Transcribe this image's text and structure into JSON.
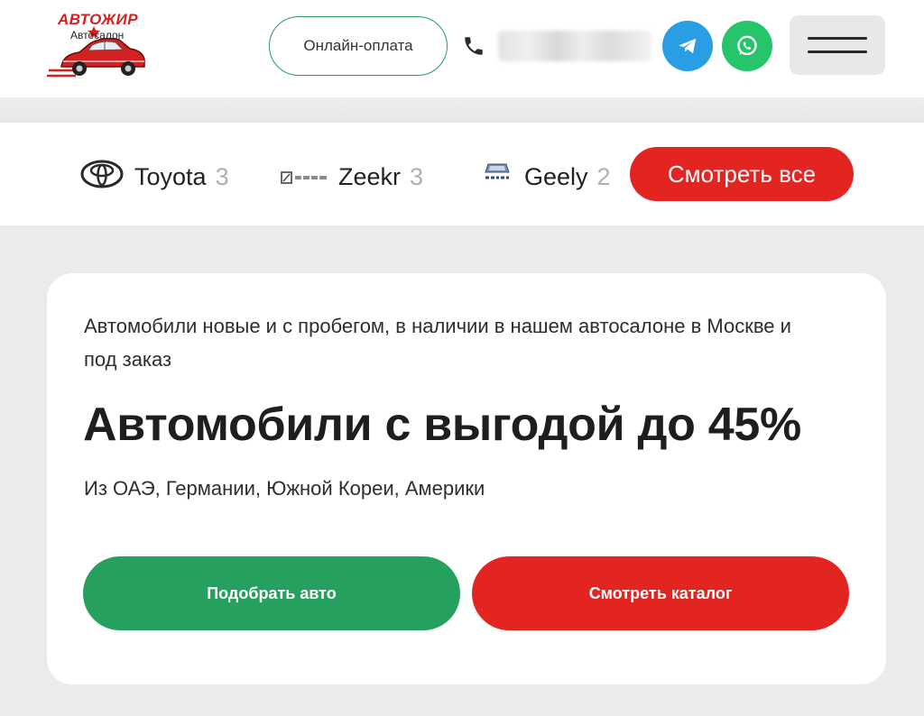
{
  "header": {
    "logo_title": "АВТОЖИР",
    "logo_subtitle": "Автосалон",
    "online_payment_label": "Онлайн-оплата",
    "phone_icon": "phone-icon",
    "telegram_icon": "telegram-icon",
    "whatsapp_icon": "whatsapp-icon",
    "menu_icon": "hamburger-menu-icon"
  },
  "brands": {
    "items": [
      {
        "name": "Toyota",
        "count": "3",
        "icon": "toyota-logo-icon"
      },
      {
        "name": "Zeekr",
        "count": "3",
        "icon": "zeekr-logo-icon"
      },
      {
        "name": "Geely",
        "count": "2",
        "icon": "geely-logo-icon"
      }
    ],
    "see_all_label": "Смотреть все"
  },
  "hero": {
    "subtitle": "Автомобили новые и с пробегом, в наличии в нашем автосалоне в Москве и под заказ",
    "title": "Автомобили с выгодой до 45%",
    "countries": "Из ОАЭ, Германии, Южной Кореи, Америки",
    "pick_button_label": "Подобрать авто",
    "catalog_button_label": "Смотреть каталог"
  },
  "colors": {
    "green": "#25a05e",
    "red": "#e32522",
    "telegram": "#2a9ee4",
    "whatsapp": "#26c46b",
    "page_bg": "#ebebeb"
  }
}
